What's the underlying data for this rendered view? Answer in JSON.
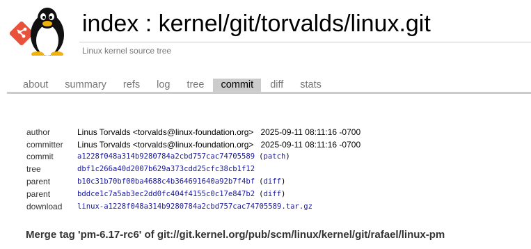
{
  "header": {
    "title": "index : kernel/git/torvalds/linux.git",
    "description": "Linux kernel source tree"
  },
  "tabs": [
    {
      "label": "about"
    },
    {
      "label": "summary"
    },
    {
      "label": "refs"
    },
    {
      "label": "log"
    },
    {
      "label": "tree"
    },
    {
      "label": "commit",
      "active": true
    },
    {
      "label": "diff"
    },
    {
      "label": "stats"
    }
  ],
  "commit": {
    "author_label": "author",
    "author": "Linus Torvalds <torvalds@linux-foundation.org>",
    "author_date": "2025-09-11 08:11:16 -0700",
    "committer_label": "committer",
    "committer": "Linus Torvalds <torvalds@linux-foundation.org>",
    "committer_date": "2025-09-11 08:11:16 -0700",
    "commit_label": "commit",
    "commit_hash": "a1228f048a314b9280784a2cbd757cac74705589",
    "patch_label": "patch",
    "tree_label": "tree",
    "tree_hash": "dbf1c266a40d2007b629a373cdd25cfc38cb1f12",
    "parent_label": "parent",
    "parent1_hash": "b10c31b70bf00ba4688c4b364691640a92b7f4bf",
    "parent2_hash": "bddce1c7a5ab3ec2dd0fc404f4155c0c17e847b2",
    "diff_label": "diff",
    "download_label": "download",
    "download_file": "linux-a1228f048a314b9280784a2cbd757cac74705589.tar.gz",
    "open_paren": "(",
    "close_paren": ")"
  },
  "subject": "Merge tag 'pm-6.17-rc6' of git://git.kernel.org/pub/scm/linux/kernel/git/rafael/linux-pm",
  "colors": {
    "link": "#1a1a9a",
    "tab_active_bg": "#cccccc",
    "muted_text": "#777777",
    "git_logo": "#e8523a"
  }
}
